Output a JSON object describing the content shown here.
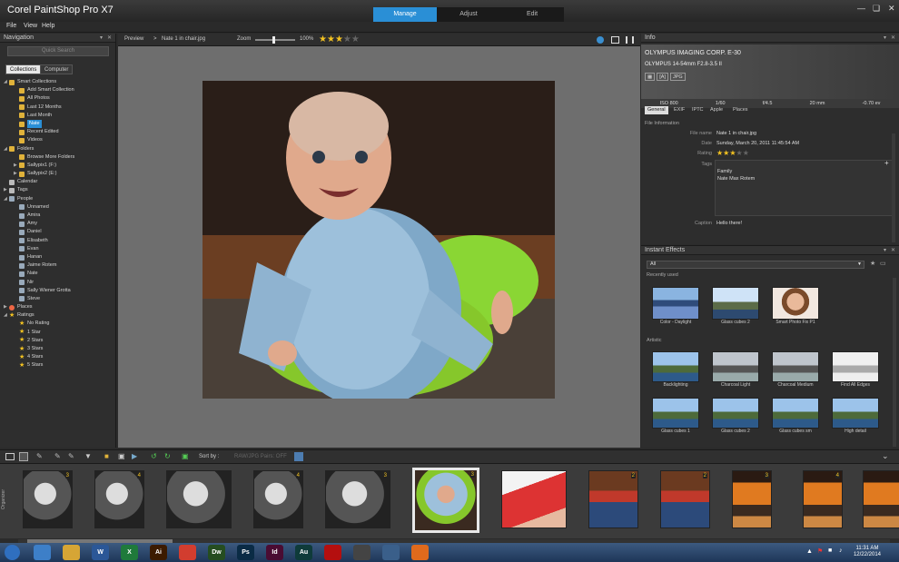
{
  "app": {
    "title": "Corel PaintShop Pro X7"
  },
  "modes": [
    {
      "label": "Manage",
      "active": true
    },
    {
      "label": "Adjust",
      "active": false
    },
    {
      "label": "Edit",
      "active": false
    }
  ],
  "menu": [
    "File",
    "View",
    "Help"
  ],
  "navigation": {
    "title": "Navigation",
    "search_placeholder": "Quick Search",
    "tabs": [
      {
        "label": "Collections",
        "active": true
      },
      {
        "label": "Computer",
        "active": false
      }
    ],
    "tree": [
      {
        "label": "Smart Collections",
        "level": 0,
        "icon": "folder-icon",
        "expanded": true
      },
      {
        "label": "Add Smart Collection",
        "level": 1,
        "icon": "smart-collection-icon"
      },
      {
        "label": "All Photos",
        "level": 1,
        "icon": "smart-collection-icon"
      },
      {
        "label": "Last 12 Months",
        "level": 1,
        "icon": "smart-collection-icon"
      },
      {
        "label": "Last Month",
        "level": 1,
        "icon": "smart-collection-icon"
      },
      {
        "label": "Nate",
        "level": 1,
        "icon": "smart-collection-icon",
        "selected": true
      },
      {
        "label": "Recent Edited",
        "level": 1,
        "icon": "smart-collection-icon"
      },
      {
        "label": "Videos",
        "level": 1,
        "icon": "smart-collection-icon"
      },
      {
        "label": "Folders",
        "level": 0,
        "icon": "folder-icon",
        "expanded": true
      },
      {
        "label": "Browse More Folders",
        "level": 1,
        "icon": "folder-icon"
      },
      {
        "label": "Sallypix1 (F:)",
        "level": 1,
        "icon": "folder-icon",
        "collapsed": true
      },
      {
        "label": "Sallypix2 (E:)",
        "level": 1,
        "icon": "folder-icon",
        "collapsed": true
      },
      {
        "label": "Calendar",
        "level": 0,
        "icon": "calendar-icon"
      },
      {
        "label": "Tags",
        "level": 0,
        "icon": "tag-icon",
        "collapsed": true
      },
      {
        "label": "People",
        "level": 0,
        "icon": "person-icon",
        "expanded": true
      },
      {
        "label": "Unnamed",
        "level": 1,
        "icon": "person-icon"
      },
      {
        "label": "Amira",
        "level": 1,
        "icon": "person-icon"
      },
      {
        "label": "Amy",
        "level": 1,
        "icon": "person-icon"
      },
      {
        "label": "Daniel",
        "level": 1,
        "icon": "person-icon"
      },
      {
        "label": "Elisabeth",
        "level": 1,
        "icon": "person-icon"
      },
      {
        "label": "Evan",
        "level": 1,
        "icon": "person-icon"
      },
      {
        "label": "Hanan",
        "level": 1,
        "icon": "person-icon"
      },
      {
        "label": "Jaime Rotem",
        "level": 1,
        "icon": "person-icon"
      },
      {
        "label": "Nate",
        "level": 1,
        "icon": "person-icon"
      },
      {
        "label": "Nir",
        "level": 1,
        "icon": "person-icon"
      },
      {
        "label": "Sally Wiener Grotta",
        "level": 1,
        "icon": "person-icon"
      },
      {
        "label": "Steve",
        "level": 1,
        "icon": "person-icon"
      },
      {
        "label": "Places",
        "level": 0,
        "icon": "pin-icon",
        "collapsed": true
      },
      {
        "label": "Ratings",
        "level": 0,
        "icon": "star-icon",
        "expanded": true
      },
      {
        "label": "No Rating",
        "level": 1,
        "icon": "star-icon"
      },
      {
        "label": "1 Star",
        "level": 1,
        "icon": "star-icon"
      },
      {
        "label": "2 Stars",
        "level": 1,
        "icon": "star-icon"
      },
      {
        "label": "3 Stars",
        "level": 1,
        "icon": "star-icon"
      },
      {
        "label": "4 Stars",
        "level": 1,
        "icon": "star-icon"
      },
      {
        "label": "5 Stars",
        "level": 1,
        "icon": "star-icon"
      }
    ]
  },
  "preview": {
    "label": "Preview",
    "separator": ">",
    "filename": "Nate 1 in chair.jpg",
    "zoom_label": "Zoom",
    "zoom_value": "100%",
    "rating": 3,
    "rating_max": 5
  },
  "info": {
    "title": "Info",
    "camera_make": "OLYMPUS IMAGING CORP.  E-30",
    "lens": "OLYMPUS 14-54mm F2.8-3.5 II",
    "badges": [
      "[A]",
      "JPG"
    ],
    "exif": [
      "ISO 800",
      "1/60",
      "f/4.5",
      "20 mm",
      "-0.70 ev"
    ],
    "tabs": [
      {
        "label": "General",
        "active": true
      },
      {
        "label": "EXIF"
      },
      {
        "label": "IPTC"
      },
      {
        "label": "Apple"
      },
      {
        "label": "Places"
      }
    ],
    "section": "File Information",
    "file_name_label": "File name",
    "file_name": "Nate 1 in chair.jpg",
    "date_label": "Date",
    "date": "Sunday, March 20, 2011 11:45:54 AM",
    "rating_label": "Rating",
    "rating": 3,
    "tags_label": "Tags",
    "tags": [
      "Family",
      "Nate Max Rotem"
    ],
    "caption_label": "Caption",
    "caption": "Hello there!"
  },
  "effects": {
    "title": "Instant Effects",
    "category": "All",
    "recent_label": "Recently used",
    "recent": [
      "Color - Daylight",
      "Glass cubes 2",
      "Smart Photo Fix P1"
    ],
    "artistic_label": "Artistic",
    "artistic": [
      "Backlighting",
      "Charcoal Light",
      "Charcoal Medium",
      "Find All Edges",
      "Glass cubes 1",
      "Glass cubes 2",
      "Glass cubes sm",
      "High detail"
    ]
  },
  "organizer": {
    "sort_label": "Sort by :",
    "filter_label": "RAW/JPG Pairs: OFF",
    "side_label": "Organizer"
  },
  "filmstrip": [
    {
      "stars": "3",
      "tone": "bw"
    },
    {
      "stars": "4",
      "tone": "bw"
    },
    {
      "stars": "",
      "tone": "bw"
    },
    {
      "stars": "4",
      "tone": "bw"
    },
    {
      "stars": "3",
      "tone": "bw"
    },
    {
      "stars": "3",
      "tone": "baby",
      "selected": true
    },
    {
      "stars": "",
      "tone": "red"
    },
    {
      "stars": "2",
      "tone": "color"
    },
    {
      "stars": "2",
      "tone": "color"
    },
    {
      "stars": "3",
      "tone": "orange"
    },
    {
      "stars": "4",
      "tone": "orange"
    },
    {
      "stars": "4",
      "tone": "orange"
    },
    {
      "stars": "",
      "tone": "orange"
    }
  ],
  "taskbar": {
    "apps": [
      {
        "name": "start-orb-icon",
        "text": "",
        "color": "#2f6fc0"
      },
      {
        "name": "quill-icon",
        "text": "",
        "color": "#3d7fc8"
      },
      {
        "name": "explorer-icon",
        "text": "",
        "color": "#d6a535"
      },
      {
        "name": "word-icon",
        "text": "W",
        "color": "#2b5797"
      },
      {
        "name": "excel-icon",
        "text": "X",
        "color": "#1f7a3b"
      },
      {
        "name": "illustrator-icon",
        "text": "Ai",
        "color": "#3c1b00"
      },
      {
        "name": "chrome-icon",
        "text": "",
        "color": "#d23d2f"
      },
      {
        "name": "dreamweaver-icon",
        "text": "Dw",
        "color": "#254d20"
      },
      {
        "name": "photoshop-icon",
        "text": "Ps",
        "color": "#0a2b45"
      },
      {
        "name": "indesign-icon",
        "text": "Id",
        "color": "#4a0c32"
      },
      {
        "name": "audition-icon",
        "text": "Au",
        "color": "#0f3b3a"
      },
      {
        "name": "acrobat-icon",
        "text": "",
        "color": "#b40f0f"
      },
      {
        "name": "paintshop-icon",
        "text": "",
        "color": "#444"
      },
      {
        "name": "network-icon",
        "text": "",
        "color": "#3a5f8a"
      },
      {
        "name": "firefox-icon",
        "text": "",
        "color": "#e06a1c"
      }
    ],
    "time": "11:31 AM",
    "date": "12/22/2014"
  },
  "colors": {
    "accent": "#2a8fd6",
    "star": "#f3c221"
  }
}
